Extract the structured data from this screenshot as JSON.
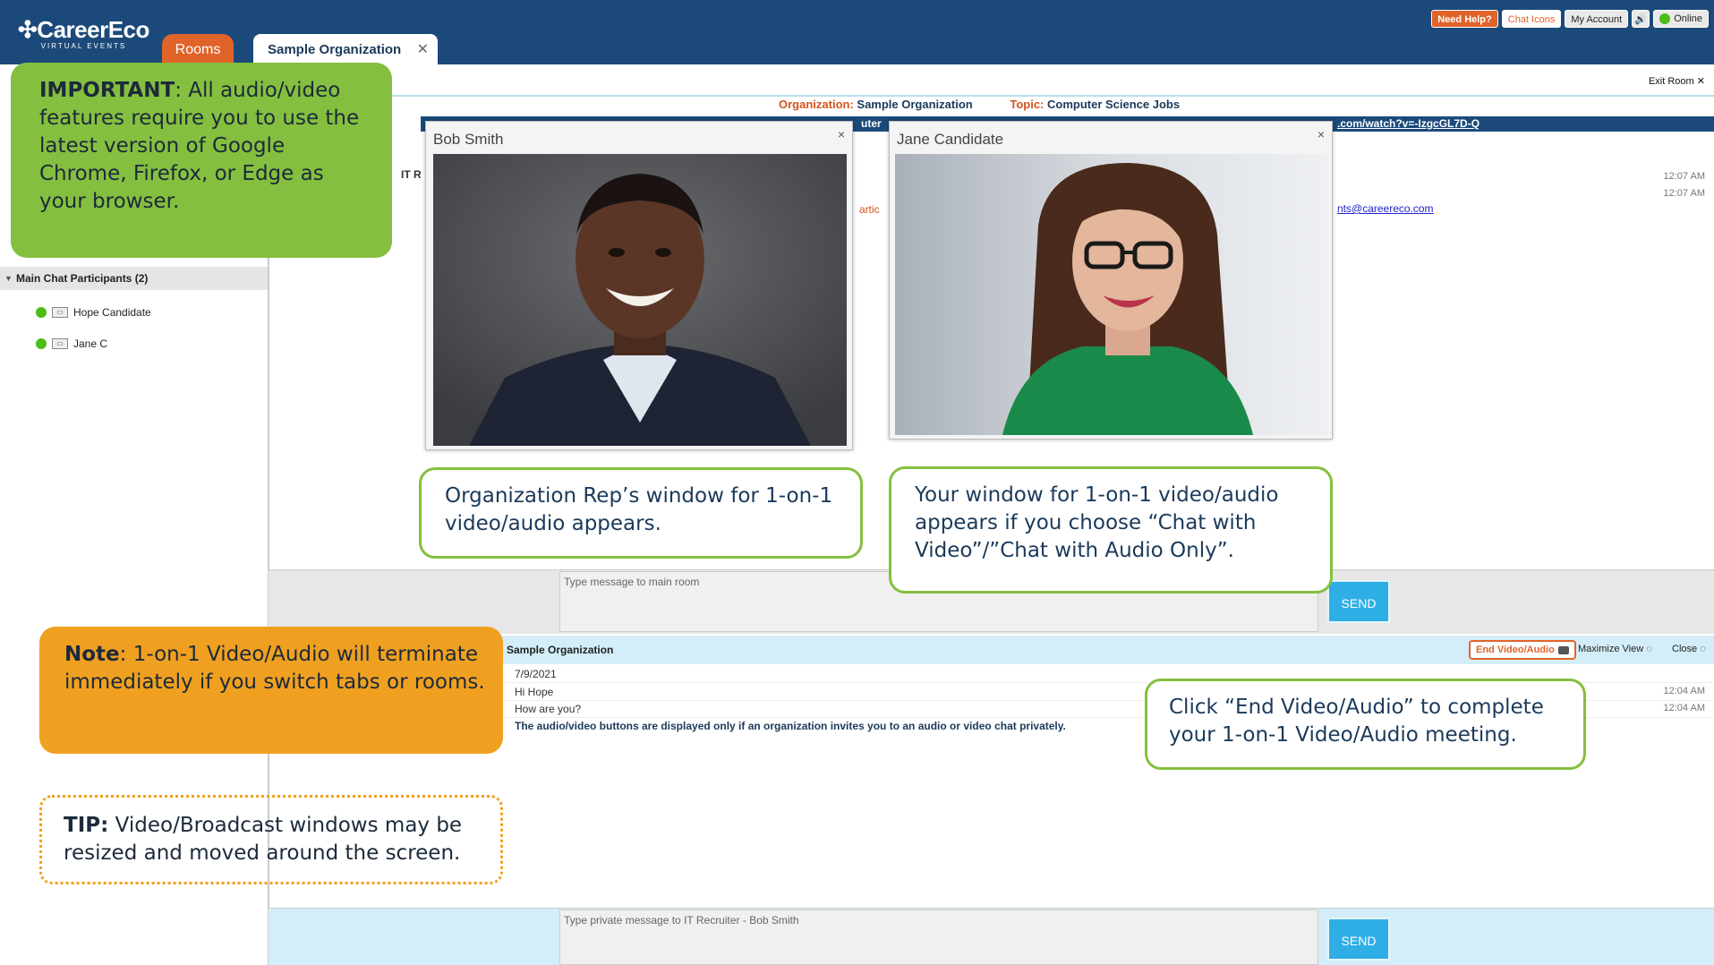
{
  "app": {
    "logo": "CareerEco",
    "logo_sub": "VIRTUAL EVENTS",
    "tabs": [
      {
        "label": "Rooms"
      },
      {
        "label": "Sample Organization",
        "close": "✕"
      }
    ],
    "top_buttons": {
      "need_help": "Need Help?",
      "chat_icons": "Chat Icons",
      "my_account": "My Account",
      "online": "Online"
    },
    "exit_room": "Exit Room"
  },
  "room": {
    "org_label": "Organization:",
    "org_value": "Sample Organization",
    "topic_label": "Topic:",
    "topic_value": "Computer Science Jobs",
    "strip_link": ".com/watch?v=-IzgcGL7D-Q",
    "strip_fragment": "uter",
    "it_fragment": "IT R",
    "parti_fragment": "artic",
    "email_link": "nts@careereco.com",
    "times": [
      "12:07 AM",
      "12:07 AM"
    ]
  },
  "sidebar": {
    "participants_header": "Main Chat Participants (2)",
    "participants": [
      {
        "name": "Hope Candidate",
        "status_color": "#4cbb17"
      },
      {
        "name": "Jane C",
        "status_color": "#4cbb17"
      }
    ]
  },
  "video_windows": [
    {
      "title": "Bob Smith",
      "close": "×"
    },
    {
      "title": "Jane Candidate",
      "close": "×"
    }
  ],
  "main_input": {
    "placeholder": "Type message to main room",
    "send": "SEND"
  },
  "private_chat": {
    "title": "Sample Organization",
    "end_button": "End Video/Audio",
    "maximize": "Maximize View",
    "close": "Close",
    "lines": [
      {
        "text": "7/9/2021",
        "time": ""
      },
      {
        "text": "Hi Hope",
        "time": "12:04 AM"
      },
      {
        "text": "How are you?",
        "time": "12:04 AM"
      },
      {
        "text": "The audio/video buttons are displayed only if an organization invites you to an audio or video chat privately.",
        "time": ""
      }
    ],
    "placeholder": "Type private message to IT Recruiter - Bob Smith",
    "send": "SEND"
  },
  "callouts": {
    "important_label": "IMPORTANT",
    "important_text": ":  All audio/video features require you to use the latest version of Google Chrome, Firefox, or Edge as your browser.",
    "note_label": "Note",
    "note_text": ": 1-on-1 Video/Audio will terminate immediately if you switch tabs or rooms.",
    "rep_window": "Organization Rep’s window for 1-on-1 video/audio appears.",
    "your_window": "Your window for 1-on-1 video/audio appears if you choose “Chat with Video”/”Chat with Audio Only”.",
    "end_video": "Click “End Video/Audio” to complete your 1-on-1 Video/Audio meeting.",
    "tip_label": "TIP:",
    "tip_text": " Video/Broadcast windows may be resized and moved around the screen."
  },
  "colors": {
    "header_bg": "#1b4a7a",
    "accent_orange": "#e0632a",
    "callout_green": "#85bf3f",
    "callout_orange": "#f0a020",
    "send_blue": "#2faee6"
  }
}
